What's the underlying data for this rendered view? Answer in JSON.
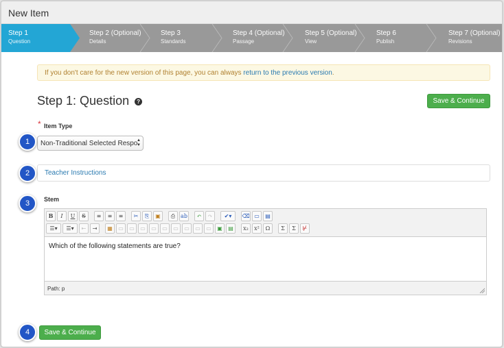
{
  "window": {
    "title": "New Item"
  },
  "steps": [
    {
      "title": "Step 1",
      "optional": "",
      "sub": "Question"
    },
    {
      "title": "Step 2",
      "optional": "(Optional)",
      "sub": "Details"
    },
    {
      "title": "Step 3",
      "optional": "",
      "sub": "Standards"
    },
    {
      "title": "Step 4",
      "optional": "(Optional)",
      "sub": "Passage"
    },
    {
      "title": "Step 5",
      "optional": "(Optional)",
      "sub": "View"
    },
    {
      "title": "Step 6",
      "optional": "",
      "sub": "Publish"
    },
    {
      "title": "Step 7",
      "optional": "(Optional)",
      "sub": "Revisions"
    }
  ],
  "notice": {
    "text": "If you don't care for the new version of this page, you can always ",
    "link": "return to the previous version",
    "end": "."
  },
  "page": {
    "title": "Step 1: Question",
    "help_icon": "question-circle-icon"
  },
  "buttons": {
    "save_top": "Save & Continue",
    "save_bottom": "Save & Continue"
  },
  "item_type": {
    "label": "Item Type",
    "required_mark": "*",
    "value": "Non-Traditional Selected Respo"
  },
  "teacher_instructions": {
    "label": "Teacher Instructions"
  },
  "stem": {
    "label": "Stem",
    "content": "Which of the following statements are true?",
    "path": "Path: p"
  },
  "toolbar": {
    "row1": [
      "B",
      "I",
      "U",
      "S",
      "≡",
      "≡",
      "≡",
      "✂",
      "⎘",
      "📋",
      "🖶",
      "ab",
      "↶",
      "↷",
      "✔▾",
      "⌫",
      "▭",
      "▤"
    ],
    "row2": [
      "☰▾",
      "☰▾",
      "⇤",
      "⇥",
      "▦",
      "▭",
      "▭",
      "▭",
      "▭",
      "▭",
      "▭",
      "▭",
      "▭",
      "▭",
      "▣",
      "▤",
      "x₂",
      "x²",
      "Ω",
      "Σ",
      "Σ",
      "⊬"
    ]
  },
  "callouts": [
    "1",
    "2",
    "3",
    "4"
  ],
  "colors": {
    "active_step": "#23a6d5",
    "steps_bg": "#999999",
    "green": "#4cae4c",
    "badge": "#2256c6"
  }
}
